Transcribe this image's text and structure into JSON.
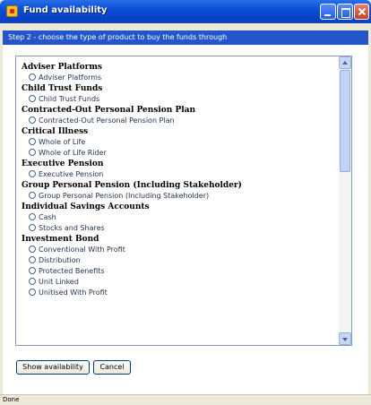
{
  "window": {
    "title": "Fund availability"
  },
  "step": {
    "text": "Step 2 - choose the type of product to buy the funds through"
  },
  "groups": [
    {
      "heading": "Adviser Platforms",
      "options": [
        "Adviser Platforms"
      ]
    },
    {
      "heading": "Child Trust Funds",
      "options": [
        "Child Trust Funds"
      ]
    },
    {
      "heading": "Contracted-Out Personal Pension Plan",
      "options": [
        "Contracted-Out Personal Pension Plan"
      ]
    },
    {
      "heading": "Critical Illness",
      "options": [
        "Whole of Life",
        "Whole of Life Rider"
      ]
    },
    {
      "heading": "Executive Pension",
      "options": [
        "Executive Pension"
      ]
    },
    {
      "heading": "Group Personal Pension (Including Stakeholder)",
      "options": [
        "Group Personal Pension (Including Stakeholder)"
      ]
    },
    {
      "heading": "Individual Savings Accounts",
      "options": [
        "Cash",
        "Stocks and Shares"
      ]
    },
    {
      "heading": "Investment Bond",
      "options": [
        "Conventional With Profit",
        "Distribution",
        "Protected Benefits",
        "Unit Linked",
        "Unitised With Profit"
      ]
    }
  ],
  "buttons": {
    "show_label": "Show availability",
    "cancel_label": "Cancel"
  },
  "status": {
    "text": "Done"
  },
  "icons": {
    "app": "fund-app-icon",
    "minimize": "minimize-icon",
    "maximize": "maximize-icon",
    "close": "close-icon",
    "radio": "radio-icon"
  },
  "colors": {
    "titlebar": "#0a4fd6",
    "stepbar": "#2356c8",
    "close": "#c8401e"
  }
}
